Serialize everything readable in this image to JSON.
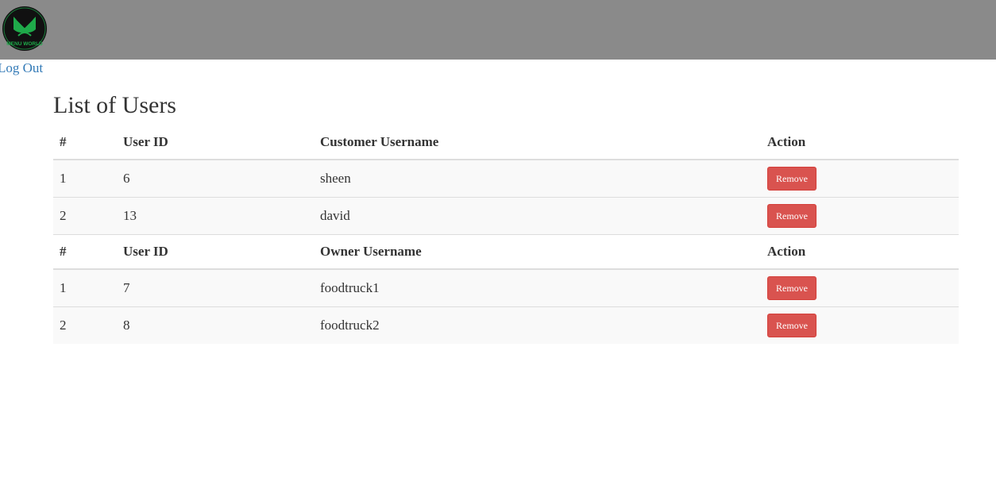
{
  "header": {
    "logo_text": "MENU WORLD",
    "bar_color": "#8a8a8a"
  },
  "nav": {
    "logout_label": "Log Out"
  },
  "page": {
    "title": "List of Users"
  },
  "customers": {
    "columns": [
      "#",
      "User ID",
      "Customer Username",
      "Action"
    ],
    "rows": [
      {
        "num": "1",
        "user_id": "6",
        "username": "sheen",
        "action": "Remove"
      },
      {
        "num": "2",
        "user_id": "13",
        "username": "david",
        "action": "Remove"
      }
    ]
  },
  "owners": {
    "columns": [
      "#",
      "User ID",
      "Owner Username",
      "Action"
    ],
    "rows": [
      {
        "num": "1",
        "user_id": "7",
        "username": "foodtruck1",
        "action": "Remove"
      },
      {
        "num": "2",
        "user_id": "8",
        "username": "foodtruck2",
        "action": "Remove"
      }
    ]
  },
  "colors": {
    "remove_button": "#d9534f",
    "link": "#337ab7"
  }
}
